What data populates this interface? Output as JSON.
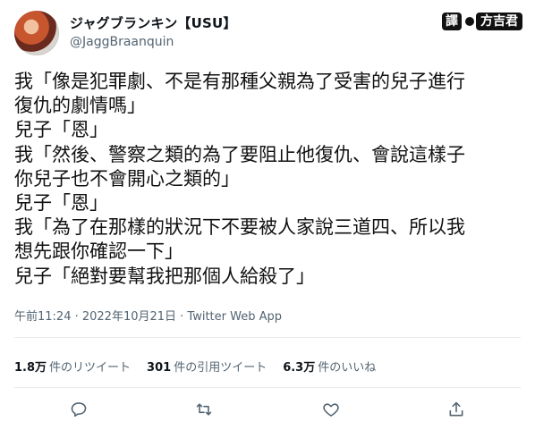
{
  "author": {
    "display_name": "ジャグブランキン【USU】",
    "handle": "@JaggBraanquin"
  },
  "watermark": {
    "mark": "譯",
    "name": "方吉君"
  },
  "tweet_lines": [
    "我「像是犯罪劇、不是有那種父親為了受害的兒子進行",
    "復仇的劇情嗎」",
    "兒子「恩」",
    "我「然後、警察之類的為了要阻止他復仇、會說這樣子",
    "你兒子也不會開心之類的」",
    "兒子「恩」",
    "我「為了在那樣的狀況下不要被人家說三道四、所以我",
    "想先跟你確認一下」",
    "兒子「絕對要幫我把那個人給殺了」"
  ],
  "meta": "午前11:24 · 2022年10月21日 · Twitter Web App",
  "stats": {
    "retweets_count": "1.8万",
    "retweets_label": "件のリツイート",
    "quotes_count": "301",
    "quotes_label": "件の引用ツイート",
    "likes_count": "6.3万",
    "likes_label": "件のいいね"
  },
  "actions": {
    "reply_icon": "reply-icon",
    "retweet_icon": "retweet-icon",
    "like_icon": "heart-icon",
    "share_icon": "share-icon"
  }
}
